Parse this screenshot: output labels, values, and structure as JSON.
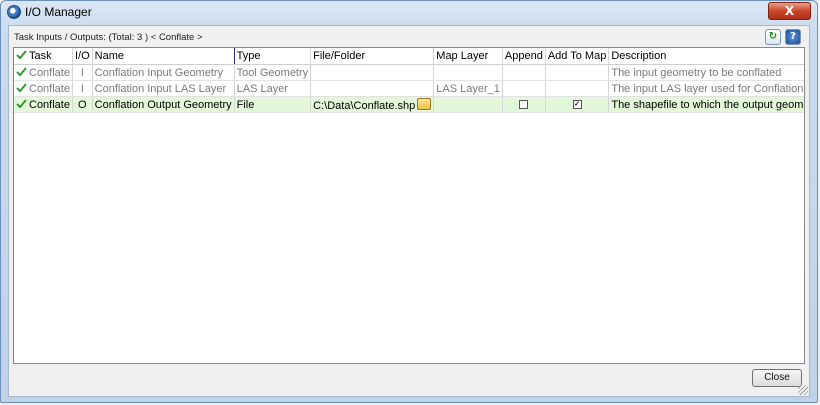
{
  "window": {
    "title": "I/O Manager",
    "close_glyph": "X"
  },
  "info_bar": {
    "text": "Task Inputs / Outputs: (Total: 3 ) < Conflate >"
  },
  "toolbar": {
    "refresh_icon": "refresh-icon",
    "help_icon": "help-icon",
    "refresh_glyph": "↻",
    "help_glyph": "?"
  },
  "grid": {
    "columns": [
      "Task",
      "I/O",
      "Name",
      "Type",
      "File/Folder",
      "Map Layer",
      "Append",
      "Add To Map",
      "Description"
    ],
    "rows": [
      {
        "task": "Conflate",
        "io": "I",
        "name": "Conflation Input Geometry",
        "type": "Tool Geometry",
        "file": "",
        "map_layer": "",
        "append": null,
        "add_to_map": null,
        "description": "The input geometry to be conflated",
        "selected": false
      },
      {
        "task": "Conflate",
        "io": "I",
        "name": "Conflation Input LAS Layer",
        "type": "LAS Layer",
        "file": "",
        "map_layer": "LAS Layer_1",
        "append": null,
        "add_to_map": null,
        "description": "The input LAS layer used for Conflation",
        "selected": false
      },
      {
        "task": "Conflate",
        "io": "O",
        "name": "Conflation Output Geometry",
        "type": "File",
        "file": "C:\\Data\\Conflate.shp",
        "map_layer": "",
        "append": false,
        "add_to_map": true,
        "description": "The shapefile to which the output geometry is written",
        "selected": true
      }
    ]
  },
  "footer": {
    "close_label": "Close"
  },
  "colors": {
    "selected_row": "#e3f7d9",
    "check": "#2e9b2e"
  }
}
